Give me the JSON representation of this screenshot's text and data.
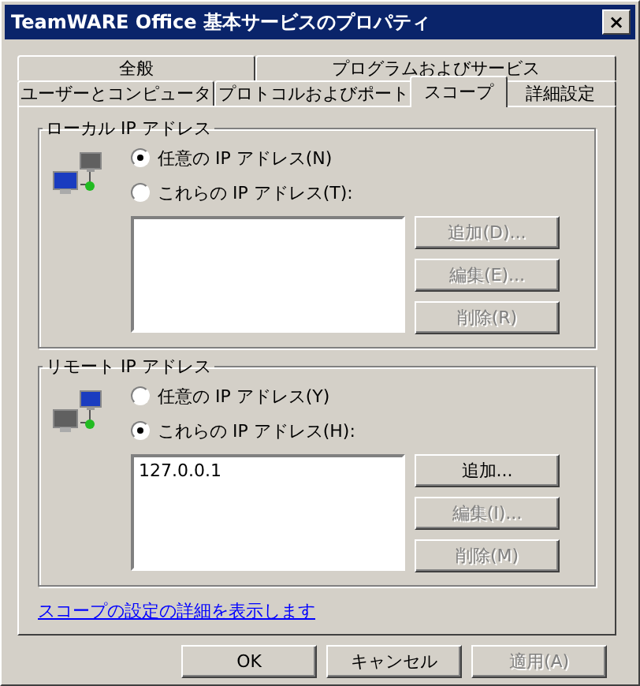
{
  "window": {
    "title": "TeamWARE Office 基本サービスのプロパティ",
    "close": "×"
  },
  "tab_rows": [
    [
      {
        "label": "全般",
        "selected": false
      },
      {
        "label": "プログラムおよびサービス",
        "selected": false
      }
    ],
    [
      {
        "label": "ユーザーとコンピュータ",
        "selected": false
      },
      {
        "label": "プロトコルおよびポート",
        "selected": false
      },
      {
        "label": "スコープ",
        "selected": true
      },
      {
        "label": "詳細設定",
        "selected": false
      }
    ]
  ],
  "groups": [
    {
      "title": "ローカル IP アドレス",
      "options": [
        {
          "label": "任意の IP アドレス(N)",
          "selected": true
        },
        {
          "label": "これらの IP アドレス(T):",
          "selected": false
        }
      ],
      "buttons": [
        {
          "label": "追加(D)...",
          "disabled": true
        },
        {
          "label": "編集(E)...",
          "disabled": true
        },
        {
          "label": "削除(R)",
          "disabled": true
        }
      ]
    },
    {
      "title": "リモート IP アドレス",
      "options": [
        {
          "label": "任意の IP アドレス(Y)",
          "selected": false
        },
        {
          "label": "これらの IP アドレス(H):",
          "selected": true
        }
      ],
      "list": [
        "127.0.0.1"
      ],
      "buttons": [
        {
          "label": "追加...",
          "disabled": false
        },
        {
          "label": "編集(I)...",
          "disabled": true
        },
        {
          "label": "削除(M)",
          "disabled": true
        }
      ]
    }
  ],
  "link": "スコープの設定の詳細を表示します",
  "footer_buttons": [
    {
      "label": "OK",
      "disabled": false
    },
    {
      "label": "キャンセル",
      "disabled": false
    },
    {
      "label": "適用(A)",
      "disabled": true
    }
  ]
}
